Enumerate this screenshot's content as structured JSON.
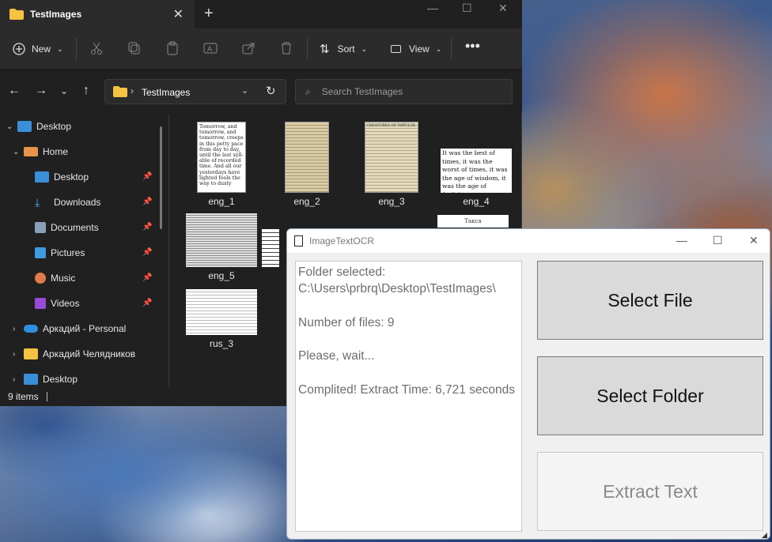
{
  "explorer": {
    "tab_title": "TestImages",
    "toolbar": {
      "new_label": "New",
      "sort_label": "Sort",
      "view_label": "View"
    },
    "address": {
      "path": "TestImages",
      "search_placeholder": "Search TestImages"
    },
    "nav": [
      {
        "label": "Desktop"
      },
      {
        "label": "Home"
      },
      {
        "label": "Desktop"
      },
      {
        "label": "Downloads"
      },
      {
        "label": "Documents"
      },
      {
        "label": "Pictures"
      },
      {
        "label": "Music"
      },
      {
        "label": "Videos"
      },
      {
        "label": "Аркадий - Personal"
      },
      {
        "label": "Аркадий Челядников"
      },
      {
        "label": "Desktop"
      }
    ],
    "files": [
      {
        "name": "eng_1",
        "thumb_text": "Tomorrow, and tomorrow, and tomorrow, creeps in this petty pace from day to day, until the last syll- able of recorded time. And all our yesterdays have lighted fools the way to dusty"
      },
      {
        "name": "eng_2"
      },
      {
        "name": "eng_3",
        "thumb_text": "CREATURES OF IMPULSE."
      },
      {
        "name": "eng_4",
        "thumb_text": "It was the best of times, it was the worst of times, it was the age of wisdom, it was the age of foolishness..."
      },
      {
        "name": "eng_5"
      },
      {
        "name": "rus_3"
      },
      {
        "name": "",
        "thumb_text": "Такса"
      }
    ],
    "status": "9 items"
  },
  "ocr_app": {
    "title": "ImageTextOCR",
    "log_lines": [
      "Folder selected:",
      "C:\\Users\\prbrq\\Desktop\\TestImages\\",
      "",
      "Number of files: 9",
      "",
      "Please, wait...",
      "",
      "Complited! Extract Time: 6,721 seconds"
    ],
    "buttons": {
      "select_file": "Select File",
      "select_folder": "Select Folder",
      "extract_text": "Extract Text"
    }
  }
}
